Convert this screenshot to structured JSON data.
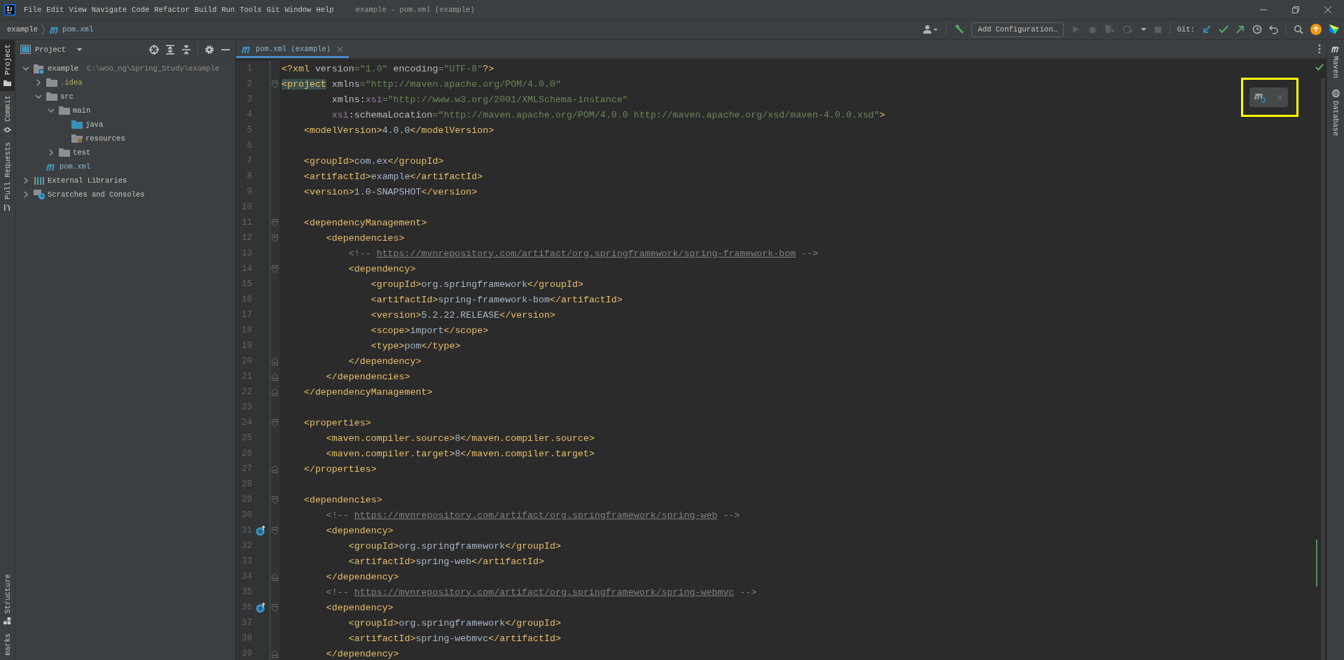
{
  "window": {
    "title": "example – pom.xml (example)",
    "menu": [
      "File",
      "Edit",
      "View",
      "Navigate",
      "Code",
      "Refactor",
      "Build",
      "Run",
      "Tools",
      "Git",
      "Window",
      "Help"
    ]
  },
  "breadcrumb": [
    {
      "label": "example",
      "kind": "module"
    },
    {
      "label": "pom.xml",
      "kind": "maven"
    }
  ],
  "toolbar": {
    "run_configuration": "Add Configuration…",
    "run_buttons_disabled": true,
    "vcs_label": "Git:"
  },
  "left_tool_tabs": [
    {
      "label": "Project",
      "selected": true
    },
    {
      "label": "Commit",
      "selected": false
    },
    {
      "label": "Pull Requests",
      "selected": false
    }
  ],
  "left_tool_tabs_bottom": [
    {
      "label": "Structure",
      "selected": false
    },
    {
      "label": "marks",
      "selected": false
    }
  ],
  "right_tool_tabs": [
    {
      "label": "Maven",
      "kind": "maven"
    },
    {
      "label": "Database",
      "kind": "database"
    }
  ],
  "project_panel": {
    "title": "Project",
    "tree": [
      {
        "label": "example",
        "path": "C:\\woo_ng\\Spring_Study\\example",
        "kind": "module",
        "expanded": true,
        "children": [
          {
            "label": ".idea",
            "kind": "ignored",
            "expanded": false
          },
          {
            "label": "src",
            "kind": "folder",
            "expanded": true,
            "children": [
              {
                "label": "main",
                "kind": "folder",
                "expanded": true,
                "children": [
                  {
                    "label": "java",
                    "kind": "source"
                  },
                  {
                    "label": "resources",
                    "kind": "resources"
                  }
                ]
              },
              {
                "label": "test",
                "kind": "folder",
                "expanded": false
              }
            ]
          },
          {
            "label": "pom.xml",
            "kind": "maven"
          }
        ]
      },
      {
        "label": "External Libraries",
        "kind": "libraries",
        "expanded": false
      },
      {
        "label": "Scratches and Consoles",
        "kind": "scratches",
        "expanded": false
      }
    ]
  },
  "editor": {
    "tabs": [
      {
        "label": "pom.xml (example)",
        "selected": true
      }
    ],
    "lines": [
      {
        "number": "1",
        "tokens": [
          {
            "kind": "tag",
            "text": "<?xml "
          },
          {
            "kind": "attr",
            "text": "version"
          },
          {
            "kind": "value",
            "text": "=\"1.0\" "
          },
          {
            "kind": "attr",
            "text": "encoding"
          },
          {
            "kind": "value",
            "text": "=\"UTF-8\""
          },
          {
            "kind": "tag",
            "text": "?>"
          }
        ]
      },
      {
        "number": "2",
        "fold_open": true,
        "tokens": [
          {
            "kind": "match",
            "text": "<project"
          },
          {
            "kind": "attr",
            "text": " xmlns"
          },
          {
            "kind": "value",
            "text": "=\"http://maven.apache.org/POM/4.0.0\""
          }
        ]
      },
      {
        "number": "3",
        "tokens": [
          {
            "kind": "attr",
            "text": "         xmlns:"
          },
          {
            "kind": "ns",
            "text": "xsi"
          },
          {
            "kind": "value",
            "text": "=\"http://www.w3.org/2001/XMLSchema-instance\""
          }
        ]
      },
      {
        "number": "4",
        "tokens": [
          {
            "kind": "ns",
            "text": "         xsi"
          },
          {
            "kind": "attr",
            "text": ":schemaLocation"
          },
          {
            "kind": "value",
            "text": "=\"http://maven.apache.org/POM/4.0.0 http://maven.apache.org/xsd/maven-4.0.0.xsd\""
          },
          {
            "kind": "tag",
            "text": ">"
          }
        ]
      },
      {
        "number": "5",
        "tokens": [
          {
            "kind": "tag",
            "text": "    <modelVersion>"
          },
          {
            "kind": "text",
            "text": "4.0.0"
          },
          {
            "kind": "tag",
            "text": "</modelVersion>"
          }
        ]
      },
      {
        "number": "6"
      },
      {
        "number": "7",
        "tokens": [
          {
            "kind": "tag",
            "text": "    <groupId>"
          },
          {
            "kind": "text",
            "text": "com.ex"
          },
          {
            "kind": "tag",
            "text": "</groupId>"
          }
        ]
      },
      {
        "number": "8",
        "tokens": [
          {
            "kind": "tag",
            "text": "    <artifactId>"
          },
          {
            "kind": "text",
            "text": "example"
          },
          {
            "kind": "tag",
            "text": "</artifactId>"
          }
        ]
      },
      {
        "number": "9",
        "tokens": [
          {
            "kind": "tag",
            "text": "    <version>"
          },
          {
            "kind": "text",
            "text": "1.0-SNAPSHOT"
          },
          {
            "kind": "tag",
            "text": "</version>"
          }
        ]
      },
      {
        "number": "10"
      },
      {
        "number": "11",
        "fold_open": true,
        "tokens": [
          {
            "kind": "tag",
            "text": "    <dependencyManagement>"
          }
        ]
      },
      {
        "number": "12",
        "fold_open": true,
        "tokens": [
          {
            "kind": "tag",
            "text": "        <dependencies>"
          }
        ]
      },
      {
        "number": "13",
        "tokens": [
          {
            "kind": "comment",
            "text": "            <!-- "
          },
          {
            "kind": "link",
            "text": "https://mvnrepository.com/artifact/org.springframework/spring-framework-bom"
          },
          {
            "kind": "comment",
            "text": " -->"
          }
        ]
      },
      {
        "number": "14",
        "fold_open": true,
        "tokens": [
          {
            "kind": "tag",
            "text": "            <dependency>"
          }
        ]
      },
      {
        "number": "15",
        "tokens": [
          {
            "kind": "tag",
            "text": "                <groupId>"
          },
          {
            "kind": "text",
            "text": "org.springframework"
          },
          {
            "kind": "tag",
            "text": "</groupId>"
          }
        ]
      },
      {
        "number": "16",
        "tokens": [
          {
            "kind": "tag",
            "text": "                <artifactId>"
          },
          {
            "kind": "text",
            "text": "spring-framework-bom"
          },
          {
            "kind": "tag",
            "text": "</artifactId>"
          }
        ]
      },
      {
        "number": "17",
        "tokens": [
          {
            "kind": "tag",
            "text": "                <version>"
          },
          {
            "kind": "text",
            "text": "5.2.22.RELEASE"
          },
          {
            "kind": "tag",
            "text": "</version>"
          }
        ]
      },
      {
        "number": "18",
        "tokens": [
          {
            "kind": "tag",
            "text": "                <scope>"
          },
          {
            "kind": "text",
            "text": "import"
          },
          {
            "kind": "tag",
            "text": "</scope>"
          }
        ]
      },
      {
        "number": "19",
        "tokens": [
          {
            "kind": "tag",
            "text": "                <type>"
          },
          {
            "kind": "text",
            "text": "pom"
          },
          {
            "kind": "tag",
            "text": "</type>"
          }
        ]
      },
      {
        "number": "20",
        "fold_close": true,
        "tokens": [
          {
            "kind": "tag",
            "text": "            </dependency>"
          }
        ]
      },
      {
        "number": "21",
        "fold_close": true,
        "tokens": [
          {
            "kind": "tag",
            "text": "        </dependencies>"
          }
        ]
      },
      {
        "number": "22",
        "fold_close": true,
        "tokens": [
          {
            "kind": "tag",
            "text": "    </dependencyManagement>"
          }
        ]
      },
      {
        "number": "23"
      },
      {
        "number": "24",
        "fold_open": true,
        "tokens": [
          {
            "kind": "tag",
            "text": "    <properties>"
          }
        ]
      },
      {
        "number": "25",
        "tokens": [
          {
            "kind": "tag",
            "text": "        <maven.compiler.source>"
          },
          {
            "kind": "text",
            "text": "8"
          },
          {
            "kind": "tag",
            "text": "</maven.compiler.source>"
          }
        ]
      },
      {
        "number": "26",
        "tokens": [
          {
            "kind": "tag",
            "text": "        <maven.compiler.target>"
          },
          {
            "kind": "text",
            "text": "8"
          },
          {
            "kind": "tag",
            "text": "</maven.compiler.target>"
          }
        ]
      },
      {
        "number": "27",
        "fold_close": true,
        "tokens": [
          {
            "kind": "tag",
            "text": "    </properties>"
          }
        ]
      },
      {
        "number": "28"
      },
      {
        "number": "29",
        "fold_open": true,
        "tokens": [
          {
            "kind": "tag",
            "text": "    <dependencies>"
          }
        ]
      },
      {
        "number": "30",
        "tokens": [
          {
            "kind": "comment",
            "text": "        <!-- "
          },
          {
            "kind": "link",
            "text": "https://mvnrepository.com/artifact/org.springframework/spring-web"
          },
          {
            "kind": "comment",
            "text": " -->"
          }
        ]
      },
      {
        "number": "31",
        "fold_open": true,
        "gutter_marker": true,
        "tokens": [
          {
            "kind": "tag",
            "text": "        <dependency>"
          }
        ]
      },
      {
        "number": "32",
        "tokens": [
          {
            "kind": "tag",
            "text": "            <groupId>"
          },
          {
            "kind": "text",
            "text": "org.springframework"
          },
          {
            "kind": "tag",
            "text": "</groupId>"
          }
        ]
      },
      {
        "number": "33",
        "tokens": [
          {
            "kind": "tag",
            "text": "            <artifactId>"
          },
          {
            "kind": "text",
            "text": "spring-web"
          },
          {
            "kind": "tag",
            "text": "</artifactId>"
          }
        ]
      },
      {
        "number": "34",
        "fold_close": true,
        "tokens": [
          {
            "kind": "tag",
            "text": "        </dependency>"
          }
        ]
      },
      {
        "number": "35",
        "tokens": [
          {
            "kind": "comment",
            "text": "        <!-- "
          },
          {
            "kind": "link",
            "text": "https://mvnrepository.com/artifact/org.springframework/spring-webmvc"
          },
          {
            "kind": "comment",
            "text": " -->"
          }
        ]
      },
      {
        "number": "36",
        "fold_open": true,
        "gutter_marker": true,
        "tokens": [
          {
            "kind": "tag",
            "text": "        <dependency>"
          }
        ]
      },
      {
        "number": "37",
        "tokens": [
          {
            "kind": "tag",
            "text": "            <groupId>"
          },
          {
            "kind": "text",
            "text": "org.springframework"
          },
          {
            "kind": "tag",
            "text": "</groupId>"
          }
        ]
      },
      {
        "number": "38",
        "tokens": [
          {
            "kind": "tag",
            "text": "            <artifactId>"
          },
          {
            "kind": "text",
            "text": "spring-webmvc"
          },
          {
            "kind": "tag",
            "text": "</artifactId>"
          }
        ]
      },
      {
        "number": "39",
        "fold_close": true,
        "tokens": [
          {
            "kind": "tag",
            "text": "        </dependency>"
          }
        ]
      }
    ]
  }
}
